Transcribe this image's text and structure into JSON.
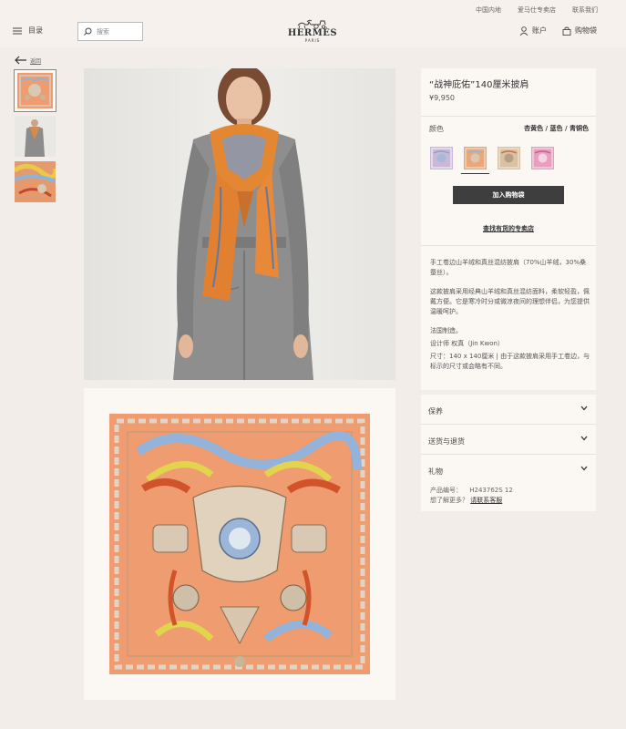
{
  "header": {
    "top_links": [
      "中国内地",
      "爱马仕专卖店",
      "联系我们"
    ],
    "menu_label": "目录",
    "search_placeholder": "搜索",
    "brand": "HERMÈS",
    "brand_city": "PARIS",
    "account_label": "账户",
    "cart_label": "购物袋"
  },
  "nav": {
    "back_label": "返回"
  },
  "product": {
    "title": "“战神庇佑”140厘米披肩",
    "price": "¥9,950",
    "color_label": "颜色",
    "color_value": "杏黄色 / 蓝色 / 青铜色",
    "swatches": [
      {
        "name": "lilac",
        "color": "#cbb7d8",
        "selected": false
      },
      {
        "name": "apricot",
        "color": "#e9a77a",
        "selected": true
      },
      {
        "name": "sand",
        "color": "#d9c2a3",
        "selected": false
      },
      {
        "name": "pink",
        "color": "#e79fbd",
        "selected": false
      }
    ],
    "add_to_bag": "加入购物袋",
    "find_store": "查找有货的专卖店",
    "desc_1": "手工卷边山羊绒和真丝混纺披肩（70%山羊绒，30%桑蚕丝）。",
    "desc_2": "这款披肩采用经典山羊绒和真丝混纺面料，柔软轻盈，佩戴方便。它是寒冷时分或微凉夜间的理想伴侣，为您提供温暖呵护。",
    "desc_3": "法国制造。",
    "designer": "设计师 权真（Jin Kwon）",
    "size_note": "尺寸：140 x 140厘米 | 由于这款披肩采用手工卷边，与标示的尺寸或会略有不同。"
  },
  "accordions": [
    {
      "label": "保养"
    },
    {
      "label": "送货与退货"
    },
    {
      "label": "礼物"
    }
  ],
  "meta": {
    "product_code_label": "产品编号：",
    "product_code": "H243762S 12",
    "more_question": "想了解更多？",
    "contact_link": "请联系客服"
  },
  "colors": {
    "background": "#f2ede8",
    "panel": "#fbf8f3",
    "button": "#3e3e3e",
    "accent_scarf": "#ee9c70"
  }
}
